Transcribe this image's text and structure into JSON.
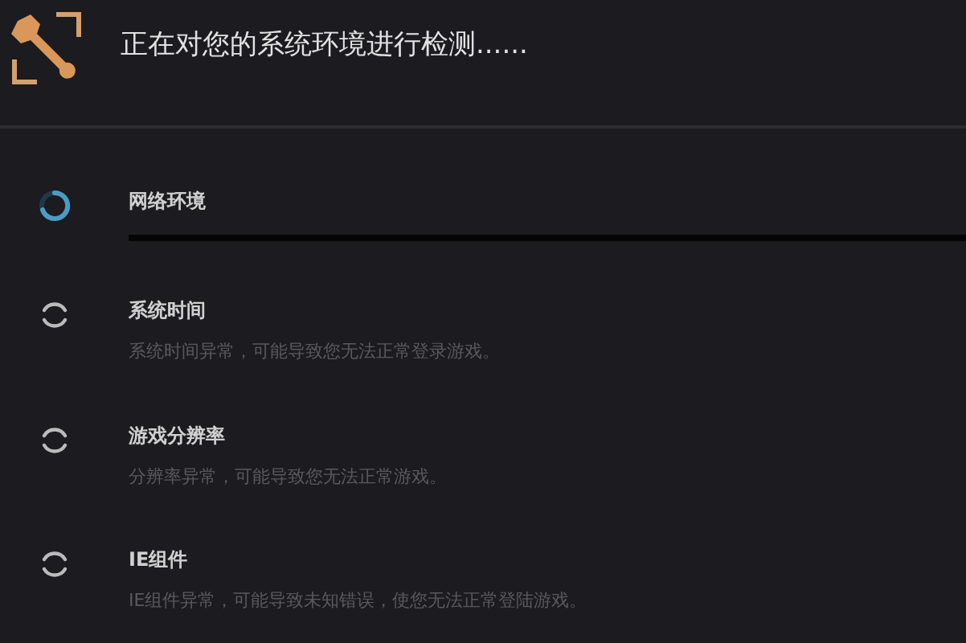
{
  "header": {
    "title": "正在对您的系统环境进行检测......"
  },
  "checks": [
    {
      "name": "网络环境",
      "checking": true
    },
    {
      "name": "系统时间",
      "checking": false,
      "description": "系统时间异常，可能导致您无法正常登录游戏。"
    },
    {
      "name": "游戏分辨率",
      "checking": false,
      "description": "分辨率异常，可能导致您无法正常游戏。"
    },
    {
      "name": "IE组件",
      "checking": false,
      "description": "IE组件异常，可能导致未知错误，使您无法正常登陆游戏。"
    }
  ]
}
